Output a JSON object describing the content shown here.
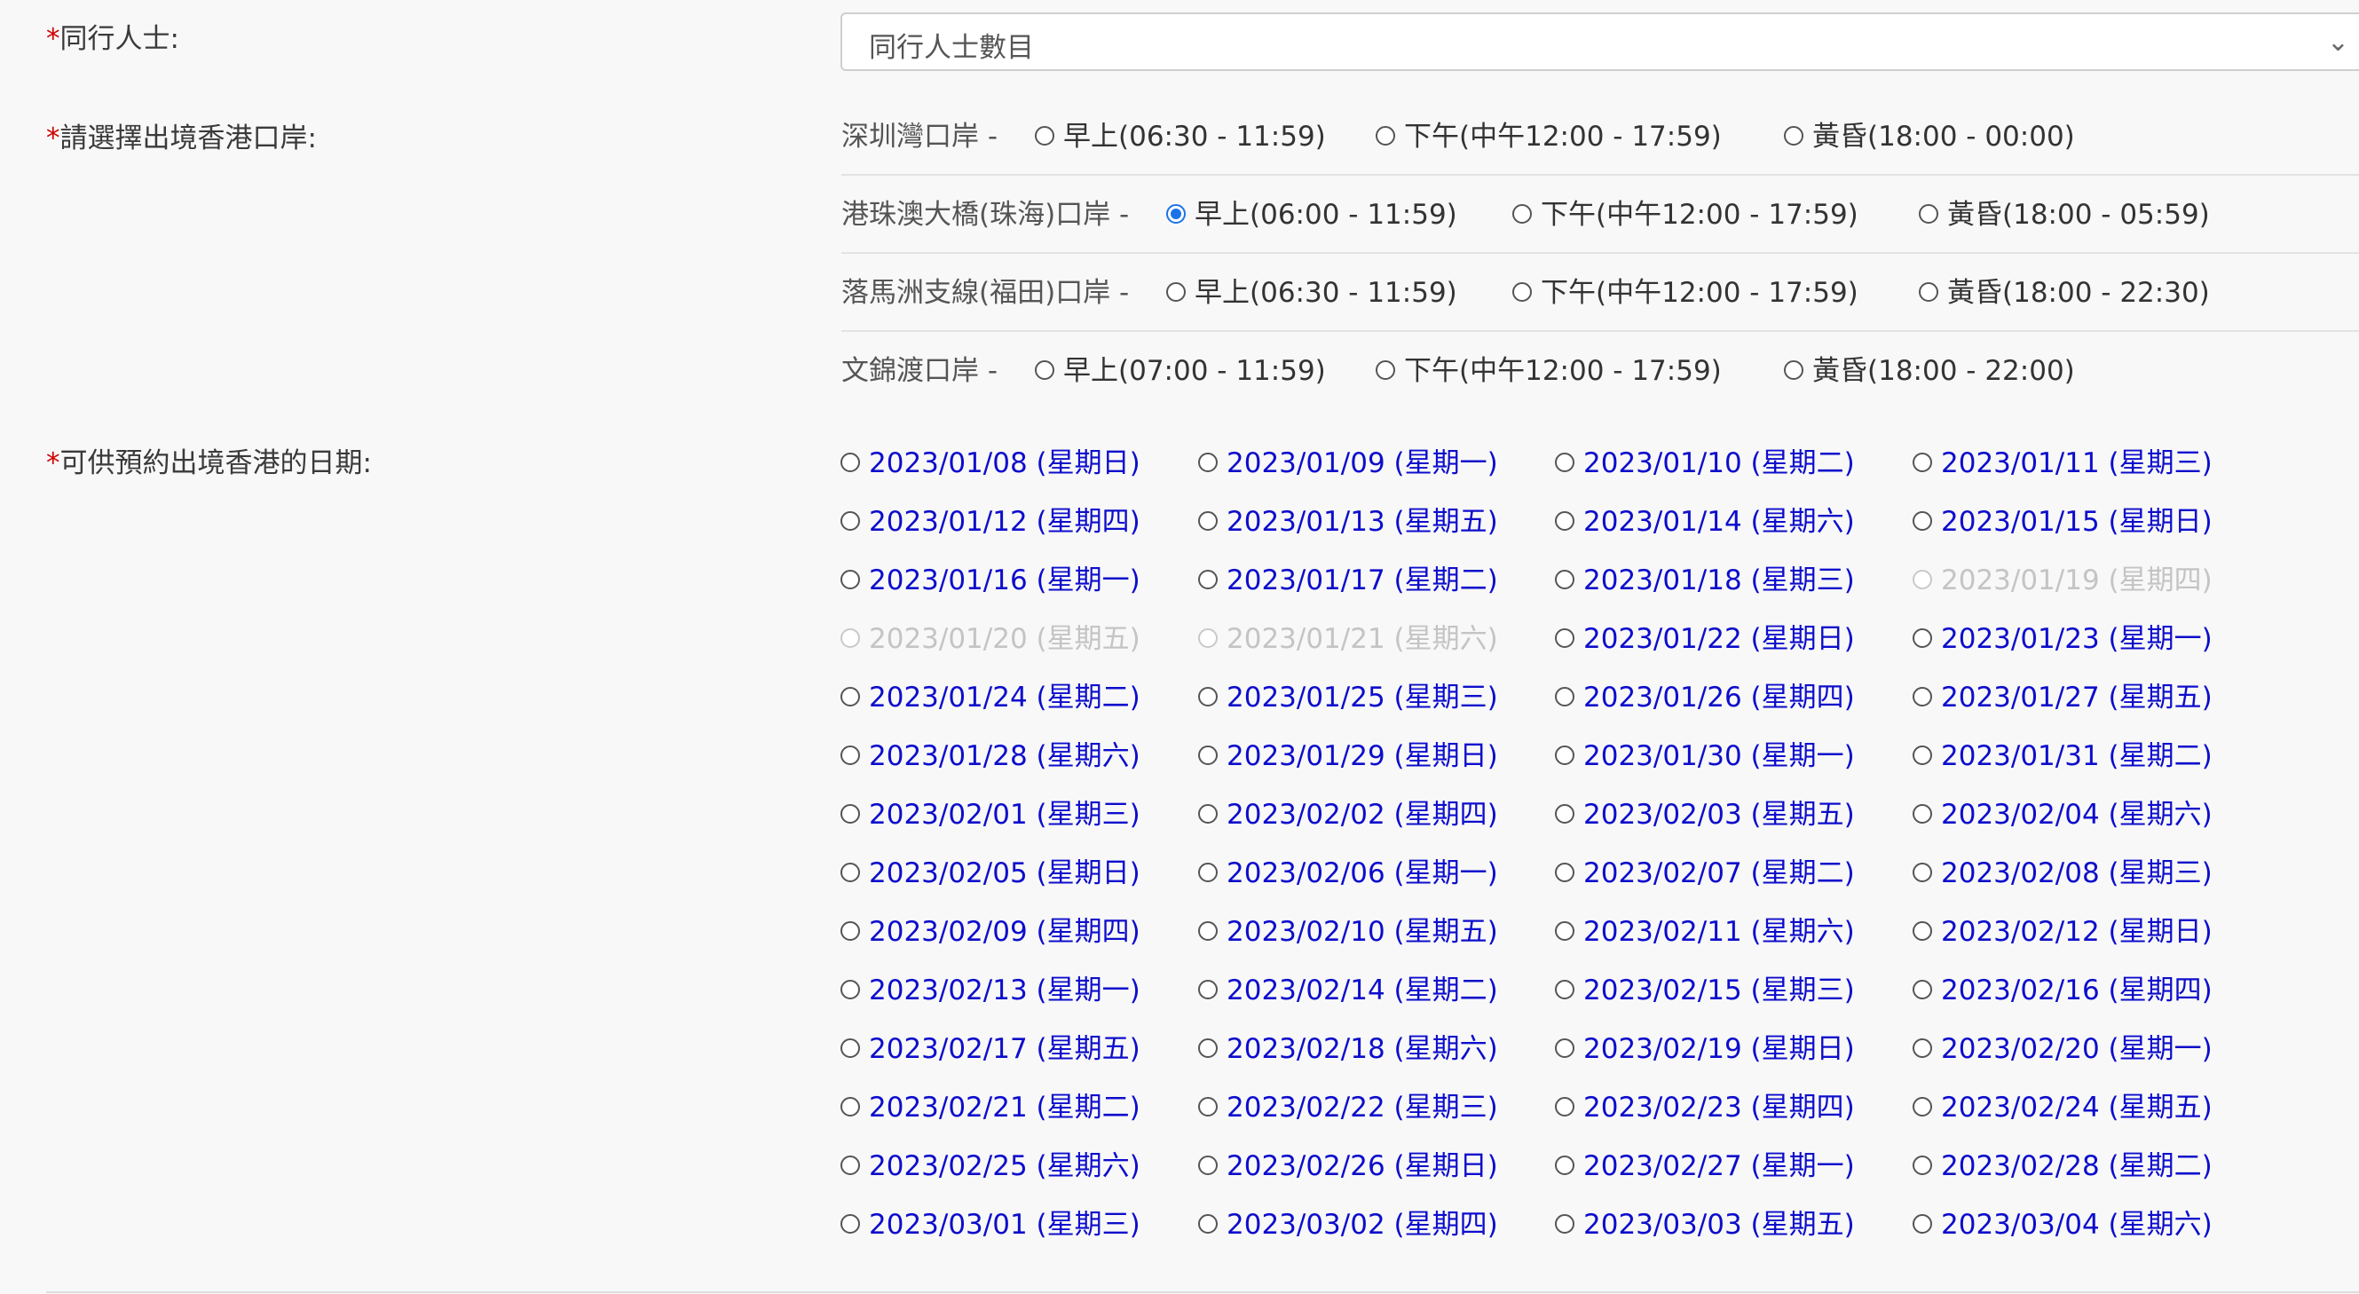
{
  "companions": {
    "label": "同行人士:",
    "required": "*",
    "placeholder": "同行人士數目",
    "chevron_icon": "chevron-down-icon"
  },
  "ports": {
    "label": "請選擇出境香港口岸:",
    "required": "*",
    "rows": [
      {
        "name": "深圳灣口岸 -",
        "options": [
          {
            "label": "早上(06:30 - 11:59)",
            "selected": false
          },
          {
            "label": "下午(中午12:00 - 17:59)",
            "selected": false
          },
          {
            "label": "黃昏(18:00 - 00:00)",
            "selected": false
          }
        ]
      },
      {
        "name": "港珠澳大橋(珠海)口岸 -",
        "options": [
          {
            "label": "早上(06:00 - 11:59)",
            "selected": true
          },
          {
            "label": "下午(中午12:00 - 17:59)",
            "selected": false
          },
          {
            "label": "黃昏(18:00 - 05:59)",
            "selected": false
          }
        ]
      },
      {
        "name": "落馬洲支線(福田)口岸 -",
        "options": [
          {
            "label": "早上(06:30 - 11:59)",
            "selected": false
          },
          {
            "label": "下午(中午12:00 - 17:59)",
            "selected": false
          },
          {
            "label": "黃昏(18:00 - 22:30)",
            "selected": false
          }
        ]
      },
      {
        "name": "文錦渡口岸 -",
        "options": [
          {
            "label": "早上(07:00 - 11:59)",
            "selected": false
          },
          {
            "label": "下午(中午12:00 - 17:59)",
            "selected": false
          },
          {
            "label": "黃昏(18:00 - 22:00)",
            "selected": false
          }
        ]
      }
    ]
  },
  "dates": {
    "label": "可供預約出境香港的日期:",
    "required": "*",
    "items": [
      {
        "label": "2023/01/08 (星期日)",
        "disabled": false
      },
      {
        "label": "2023/01/09 (星期一)",
        "disabled": false
      },
      {
        "label": "2023/01/10 (星期二)",
        "disabled": false
      },
      {
        "label": "2023/01/11 (星期三)",
        "disabled": false
      },
      {
        "label": "2023/01/12 (星期四)",
        "disabled": false
      },
      {
        "label": "2023/01/13 (星期五)",
        "disabled": false
      },
      {
        "label": "2023/01/14 (星期六)",
        "disabled": false
      },
      {
        "label": "2023/01/15 (星期日)",
        "disabled": false
      },
      {
        "label": "2023/01/16 (星期一)",
        "disabled": false
      },
      {
        "label": "2023/01/17 (星期二)",
        "disabled": false
      },
      {
        "label": "2023/01/18 (星期三)",
        "disabled": false
      },
      {
        "label": "2023/01/19 (星期四)",
        "disabled": true
      },
      {
        "label": "2023/01/20 (星期五)",
        "disabled": true
      },
      {
        "label": "2023/01/21 (星期六)",
        "disabled": true
      },
      {
        "label": "2023/01/22 (星期日)",
        "disabled": false
      },
      {
        "label": "2023/01/23 (星期一)",
        "disabled": false
      },
      {
        "label": "2023/01/24 (星期二)",
        "disabled": false
      },
      {
        "label": "2023/01/25 (星期三)",
        "disabled": false
      },
      {
        "label": "2023/01/26 (星期四)",
        "disabled": false
      },
      {
        "label": "2023/01/27 (星期五)",
        "disabled": false
      },
      {
        "label": "2023/01/28 (星期六)",
        "disabled": false
      },
      {
        "label": "2023/01/29 (星期日)",
        "disabled": false
      },
      {
        "label": "2023/01/30 (星期一)",
        "disabled": false
      },
      {
        "label": "2023/01/31 (星期二)",
        "disabled": false
      },
      {
        "label": "2023/02/01 (星期三)",
        "disabled": false
      },
      {
        "label": "2023/02/02 (星期四)",
        "disabled": false
      },
      {
        "label": "2023/02/03 (星期五)",
        "disabled": false
      },
      {
        "label": "2023/02/04 (星期六)",
        "disabled": false
      },
      {
        "label": "2023/02/05 (星期日)",
        "disabled": false
      },
      {
        "label": "2023/02/06 (星期一)",
        "disabled": false
      },
      {
        "label": "2023/02/07 (星期二)",
        "disabled": false
      },
      {
        "label": "2023/02/08 (星期三)",
        "disabled": false
      },
      {
        "label": "2023/02/09 (星期四)",
        "disabled": false
      },
      {
        "label": "2023/02/10 (星期五)",
        "disabled": false
      },
      {
        "label": "2023/02/11 (星期六)",
        "disabled": false
      },
      {
        "label": "2023/02/12 (星期日)",
        "disabled": false
      },
      {
        "label": "2023/02/13 (星期一)",
        "disabled": false
      },
      {
        "label": "2023/02/14 (星期二)",
        "disabled": false
      },
      {
        "label": "2023/02/15 (星期三)",
        "disabled": false
      },
      {
        "label": "2023/02/16 (星期四)",
        "disabled": false
      },
      {
        "label": "2023/02/17 (星期五)",
        "disabled": false
      },
      {
        "label": "2023/02/18 (星期六)",
        "disabled": false
      },
      {
        "label": "2023/02/19 (星期日)",
        "disabled": false
      },
      {
        "label": "2023/02/20 (星期一)",
        "disabled": false
      },
      {
        "label": "2023/02/21 (星期二)",
        "disabled": false
      },
      {
        "label": "2023/02/22 (星期三)",
        "disabled": false
      },
      {
        "label": "2023/02/23 (星期四)",
        "disabled": false
      },
      {
        "label": "2023/02/24 (星期五)",
        "disabled": false
      },
      {
        "label": "2023/02/25 (星期六)",
        "disabled": false
      },
      {
        "label": "2023/02/26 (星期日)",
        "disabled": false
      },
      {
        "label": "2023/02/27 (星期一)",
        "disabled": false
      },
      {
        "label": "2023/02/28 (星期二)",
        "disabled": false
      },
      {
        "label": "2023/03/01 (星期三)",
        "disabled": false
      },
      {
        "label": "2023/03/02 (星期四)",
        "disabled": false
      },
      {
        "label": "2023/03/03 (星期五)",
        "disabled": false
      },
      {
        "label": "2023/03/04 (星期六)",
        "disabled": false
      }
    ]
  },
  "colors": {
    "required": "#d10000",
    "date_link": "#0d0dcc",
    "disabled": "#c4c4c4",
    "radio_selected": "#1a73e8"
  }
}
